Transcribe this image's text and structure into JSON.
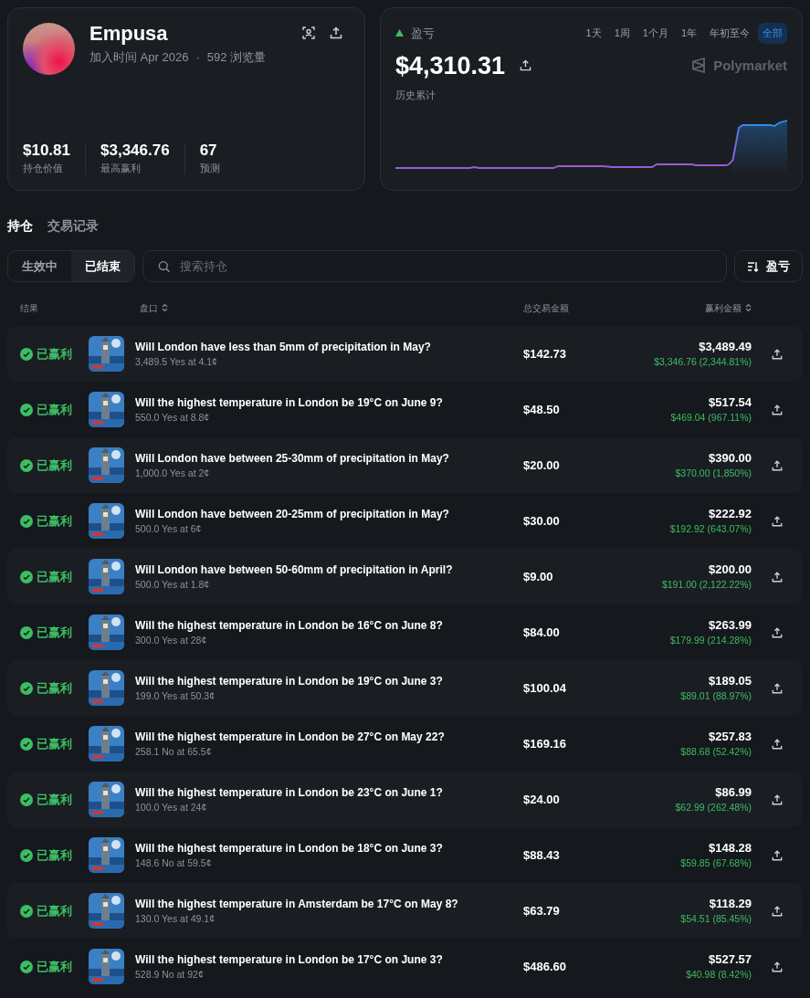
{
  "profile": {
    "name": "Empusa",
    "joined": "加入时间 Apr 2026",
    "separator": "·",
    "views": "592 浏览量",
    "stats": [
      {
        "value": "$10.81",
        "label": "持仓价值"
      },
      {
        "value": "$3,346.76",
        "label": "最高赢利"
      },
      {
        "value": "67",
        "label": "预测"
      }
    ]
  },
  "pnl": {
    "label": "盈亏",
    "value": "$4,310.31",
    "caption": "历史累计",
    "brand": "Polymarket",
    "periods": [
      {
        "label": "1天",
        "selected": false
      },
      {
        "label": "1周",
        "selected": false
      },
      {
        "label": "1个月",
        "selected": false
      },
      {
        "label": "1年",
        "selected": false
      },
      {
        "label": "年初至今",
        "selected": false
      },
      {
        "label": "全部",
        "selected": true
      }
    ]
  },
  "tabs": [
    {
      "label": "持仓",
      "selected": true
    },
    {
      "label": "交易记录",
      "selected": false
    }
  ],
  "filters": [
    {
      "label": "生效中",
      "selected": false
    },
    {
      "label": "已结束",
      "selected": true
    }
  ],
  "search": {
    "placeholder": "搜索持仓"
  },
  "sort_button": {
    "label": "盈亏"
  },
  "columns": [
    {
      "label": "结果",
      "sortable": false
    },
    {
      "label": "盘口",
      "sortable": true
    },
    {
      "label": "总交易金额",
      "sortable": false
    },
    {
      "label": "赢利金额",
      "sortable": true
    }
  ],
  "rows": [
    {
      "status": "已赢利",
      "title": "Will London have less than 5mm of precipitation in May?",
      "detail": "3,489.5 Yes at 4.1¢",
      "total": "$142.73",
      "value": "$3,489.49",
      "profit": "$3,346.76 (2,344.81%)"
    },
    {
      "status": "已赢利",
      "title": "Will the highest temperature in London be 19°C on June 9?",
      "detail": "550.0 Yes at 8.8¢",
      "total": "$48.50",
      "value": "$517.54",
      "profit": "$469.04 (967.11%)"
    },
    {
      "status": "已赢利",
      "title": "Will London have between 25-30mm of precipitation in May?",
      "detail": "1,000.0 Yes at 2¢",
      "total": "$20.00",
      "value": "$390.00",
      "profit": "$370.00 (1,850%)"
    },
    {
      "status": "已赢利",
      "title": "Will London have between 20-25mm of precipitation in May?",
      "detail": "500.0 Yes at 6¢",
      "total": "$30.00",
      "value": "$222.92",
      "profit": "$192.92 (643.07%)"
    },
    {
      "status": "已赢利",
      "title": "Will London have between 50-60mm of precipitation in April?",
      "detail": "500.0 Yes at 1.8¢",
      "total": "$9.00",
      "value": "$200.00",
      "profit": "$191.00 (2,122.22%)"
    },
    {
      "status": "已赢利",
      "title": "Will the highest temperature in London be 16°C on June 8?",
      "detail": "300.0 Yes at 28¢",
      "total": "$84.00",
      "value": "$263.99",
      "profit": "$179.99 (214.28%)"
    },
    {
      "status": "已赢利",
      "title": "Will the highest temperature in London be 19°C on June 3?",
      "detail": "199.0 Yes at 50.3¢",
      "total": "$100.04",
      "value": "$189.05",
      "profit": "$89.01 (88.97%)"
    },
    {
      "status": "已赢利",
      "title": "Will the highest temperature in London be 27°C on May 22?",
      "detail": "258.1 No at 65.5¢",
      "total": "$169.16",
      "value": "$257.83",
      "profit": "$88.68 (52.42%)"
    },
    {
      "status": "已赢利",
      "title": "Will the highest temperature in London be 23°C on June 1?",
      "detail": "100.0 Yes at 24¢",
      "total": "$24.00",
      "value": "$86.99",
      "profit": "$62.99 (262.48%)"
    },
    {
      "status": "已赢利",
      "title": "Will the highest temperature in London be 18°C on June 3?",
      "detail": "148.6 No at 59.5¢",
      "total": "$88.43",
      "value": "$148.28",
      "profit": "$59.85 (67.68%)"
    },
    {
      "status": "已赢利",
      "title": "Will the highest temperature in Amsterdam be 17°C on May 8?",
      "detail": "130.0 Yes at 49.1¢",
      "total": "$63.79",
      "value": "$118.29",
      "profit": "$54.51 (85.45%)"
    },
    {
      "status": "已赢利",
      "title": "Will the highest temperature in London be 17°C on June 3?",
      "detail": "528.9 No at 92¢",
      "total": "$486.60",
      "value": "$527.57",
      "profit": "$40.98 (8.42%)"
    }
  ]
}
